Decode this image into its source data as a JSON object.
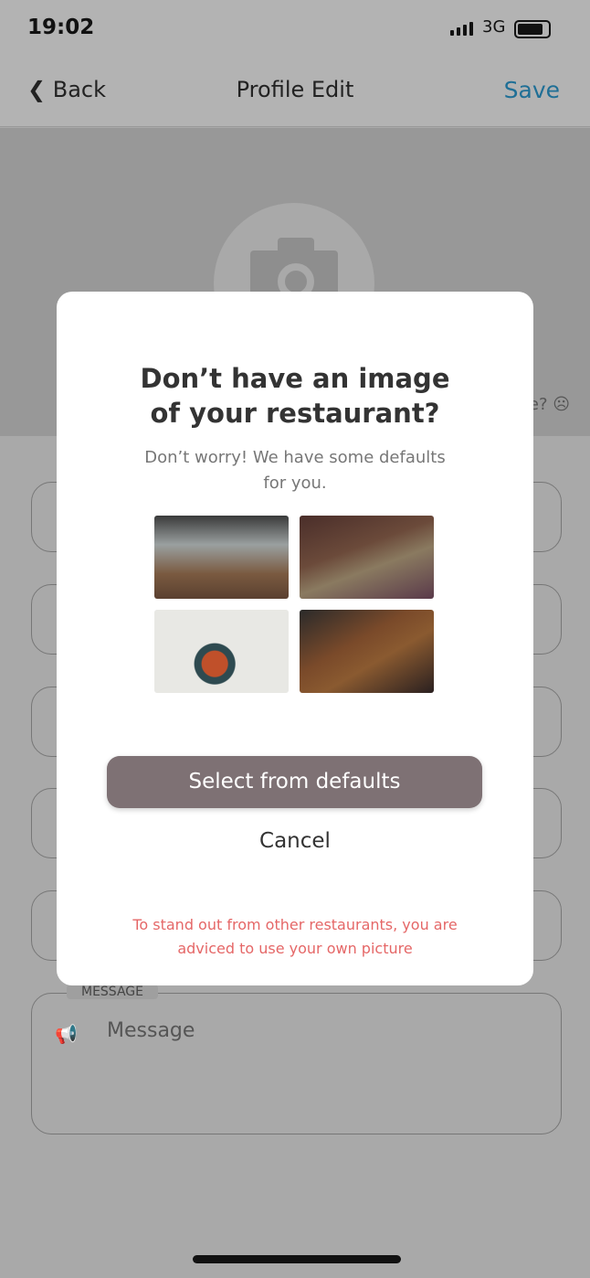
{
  "status_bar": {
    "time": "19:02",
    "network": "3G",
    "battery_level": 0.85
  },
  "nav": {
    "back_label": "Back",
    "title": "Profile Edit",
    "save_label": "Save"
  },
  "banner": {
    "hint_fragment": "e? ☹"
  },
  "form": {
    "message_label": "MESSAGE",
    "message_placeholder": "Message"
  },
  "modal": {
    "title_line1": "Don’t have an image",
    "title_line2": "of your restaurant?",
    "subtitle_line1": "Don’t worry! We have some defaults",
    "subtitle_line2": "for you.",
    "images": [
      "restaurant-interior-1",
      "restaurant-interior-2",
      "food-plate",
      "dining-table-top-view"
    ],
    "select_label": "Select from defaults",
    "cancel_label": "Cancel",
    "warning_line1": "To stand out from other restaurants, you are",
    "warning_line2": "adviced to use your own picture",
    "accent_color": "#7e7174",
    "warning_color": "#e56767"
  }
}
